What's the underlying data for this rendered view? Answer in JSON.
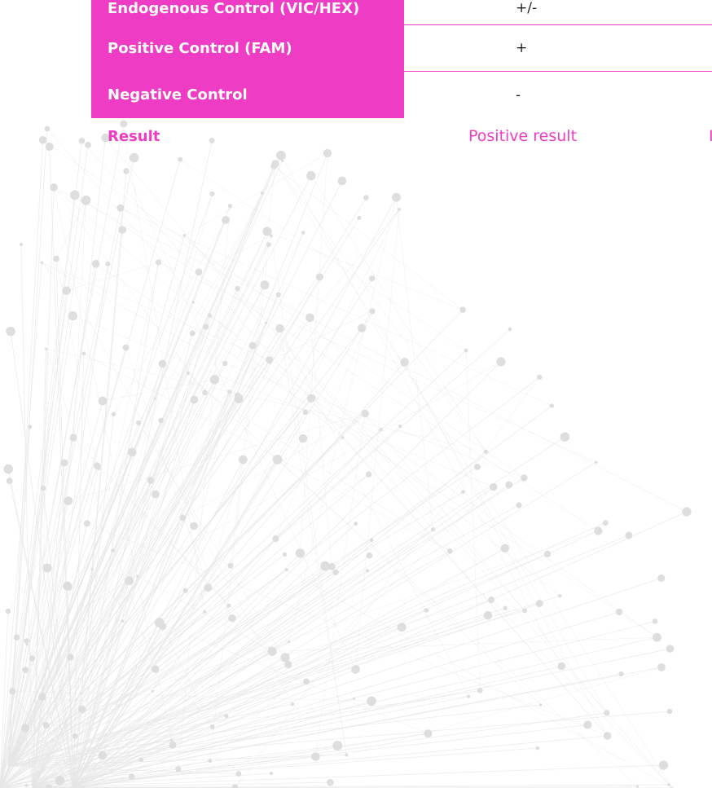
{
  "table": {
    "rows": [
      {
        "label": "Endogenous Control (VIC/HEX)",
        "value": "+/-"
      },
      {
        "label": "Positive Control (FAM)",
        "value": "+"
      },
      {
        "label": "Negative Control",
        "value": "-"
      }
    ]
  },
  "result": {
    "label": "Result",
    "value": "Positive result",
    "next_value_cut": "I"
  },
  "colors": {
    "accent": "#ef3cc4",
    "background": "#ffffff",
    "network": "#e6e6e6"
  },
  "decoration": {
    "background_graphic": "network-lines-graphic"
  }
}
